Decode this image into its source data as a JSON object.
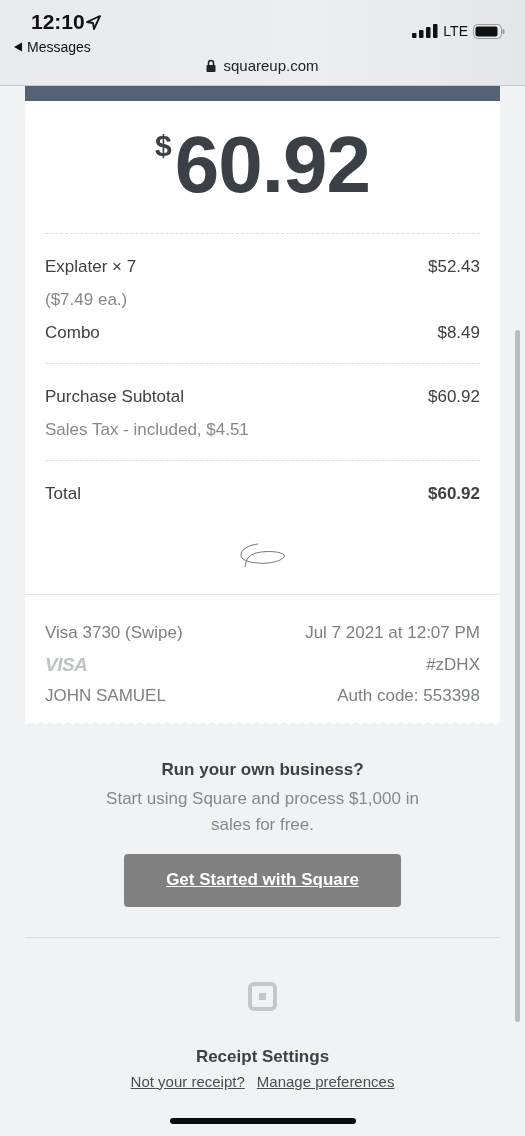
{
  "status_bar": {
    "time": "12:10",
    "back_label": "Messages",
    "network": "LTE",
    "url": "squareup.com"
  },
  "receipt": {
    "amount": {
      "currency_symbol": "$",
      "value": "60.92"
    },
    "items": [
      {
        "name": "Explater × 7",
        "price": "$52.43",
        "note": "($7.49 ea.)"
      },
      {
        "name": "Combo",
        "price": "$8.49"
      }
    ],
    "subtotal": {
      "label": "Purchase Subtotal",
      "value": "$60.92"
    },
    "tax": "Sales Tax - included, $4.51",
    "total": {
      "label": "Total",
      "value": "$60.92"
    },
    "payment": {
      "card": "Visa 3730 (Swipe)",
      "date": "Jul 7 2021 at 12:07 PM",
      "card_brand": "VISA",
      "receipt_number": "#zDHX",
      "cardholder": "JOHN SAMUEL",
      "auth_code": "Auth code: 553398"
    }
  },
  "promo": {
    "heading": "Run your own business?",
    "text": "Start using Square and process $1,000 in sales for free.",
    "button": "Get Started with Square"
  },
  "footer": {
    "heading": "Receipt Settings",
    "links": [
      "Not your receipt?",
      "Manage preferences"
    ]
  }
}
